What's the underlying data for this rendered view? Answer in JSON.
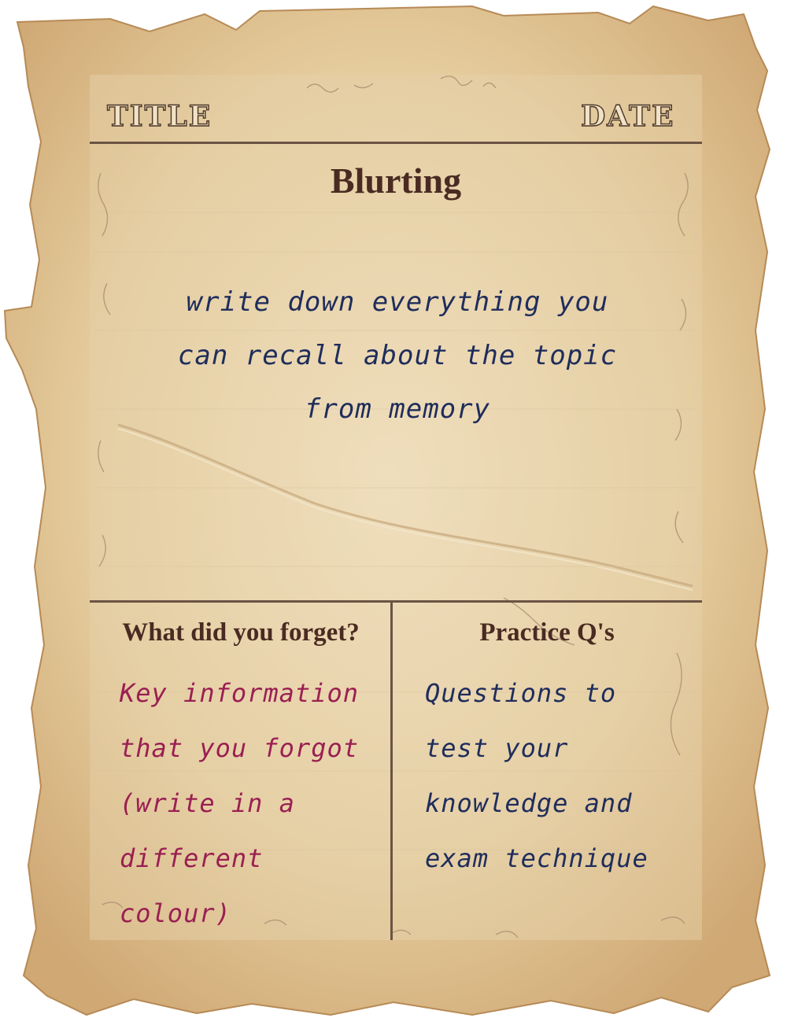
{
  "header": {
    "title_label": "TITLE",
    "date_label": "DATE"
  },
  "main": {
    "title": "Blurting",
    "body": "write down everything you can recall about the topic from memory"
  },
  "left_section": {
    "heading": "What did you forget?",
    "body": "Key information that you forgot (write in a different colour)"
  },
  "right_section": {
    "heading": "Practice Q's",
    "body": "Questions to test your knowledge and exam technique"
  },
  "colors": {
    "paper": "#e7d1a6",
    "rule": "#6b5344",
    "heading_text": "#4a2b22",
    "handwriting_blue": "#1f2d5c",
    "handwriting_pink": "#9a1f52"
  }
}
